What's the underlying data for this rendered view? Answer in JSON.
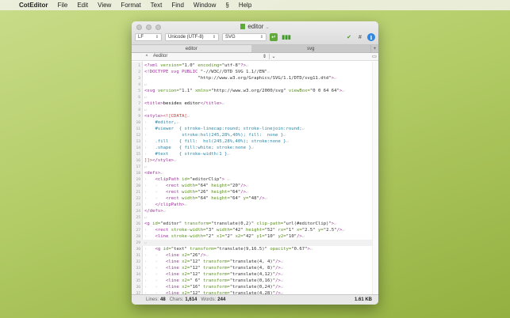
{
  "menubar": {
    "app": "CotEditor",
    "items": [
      "File",
      "Edit",
      "View",
      "Format",
      "Text",
      "Find",
      "Window",
      "Help"
    ]
  },
  "window": {
    "title": "editor"
  },
  "toolbar": {
    "line_ending": "LF",
    "encoding": "Unicode (UTF-8)",
    "syntax": "SVG"
  },
  "tabs": [
    "editor",
    "svg"
  ],
  "nav": {
    "path": "#editor"
  },
  "code": [
    [
      [
        "t-tag",
        "<?xml "
      ],
      [
        "t-attr",
        "version="
      ],
      [
        "t-str",
        "\"1.0\" "
      ],
      [
        "t-attr",
        "encoding="
      ],
      [
        "t-str",
        "\"utf-8\""
      ],
      [
        "t-tag",
        "?>"
      ],
      [
        "t-inv",
        "↵"
      ]
    ],
    [
      [
        "t-tag",
        "<!DOCTYPE svg PUBLIC "
      ],
      [
        "t-str",
        "\"-//W3C//DTD SVG 1.1//EN\""
      ],
      [
        "t-inv",
        "↵"
      ]
    ],
    [
      [
        "t-str",
        "                    \"http://www.w3.org/Graphics/SVG/1.1/DTD/svg11.dtd\""
      ],
      [
        "t-tag",
        ">"
      ],
      [
        "t-inv",
        "↵"
      ]
    ],
    [
      [
        "t-inv",
        "↵"
      ]
    ],
    [
      [
        "t-tag",
        "<svg "
      ],
      [
        "t-attr",
        "version="
      ],
      [
        "t-str",
        "\"1.1\" "
      ],
      [
        "t-attr",
        "xmlns="
      ],
      [
        "t-str",
        "\"http://www.w3.org/2000/svg\" "
      ],
      [
        "t-attr",
        "viewBox="
      ],
      [
        "t-str",
        "\"0 0 64 64\""
      ],
      [
        "t-tag",
        ">"
      ],
      [
        "t-inv",
        "↵"
      ]
    ],
    [
      [
        "t-inv",
        "↵"
      ]
    ],
    [
      [
        "t-tag",
        "<title>"
      ],
      [
        "t-txt",
        "besides editor"
      ],
      [
        "t-tag",
        "</title>"
      ],
      [
        "t-inv",
        "↵"
      ]
    ],
    [
      [
        "t-inv",
        "↵"
      ]
    ],
    [
      [
        "t-tag",
        "<style>"
      ],
      [
        "t-cd",
        "<![CDATA["
      ],
      [
        "t-inv",
        "↵"
      ]
    ],
    [
      [
        "t-inv",
        "›   "
      ],
      [
        "t-css",
        "#editor,"
      ],
      [
        "t-inv",
        "↵"
      ]
    ],
    [
      [
        "t-inv",
        "›   "
      ],
      [
        "t-css",
        "#viewer  { stroke-linecap:round; stroke-linejoin:round;"
      ],
      [
        "t-inv",
        "↵"
      ]
    ],
    [
      [
        "t-inv",
        "›   "
      ],
      [
        "t-css",
        "          stroke:hsl(245,28%,40%); fill:  none }"
      ],
      [
        "t-inv",
        "↵"
      ]
    ],
    [
      [
        "t-inv",
        "›   "
      ],
      [
        "t-css",
        ".fill    { fill:  hsl(245,28%,40%); stroke:none }"
      ],
      [
        "t-inv",
        "↵"
      ]
    ],
    [
      [
        "t-inv",
        "›   "
      ],
      [
        "t-css",
        ".shape   { fill:white; stroke:none }"
      ],
      [
        "t-inv",
        "↵"
      ]
    ],
    [
      [
        "t-inv",
        "›   "
      ],
      [
        "t-css",
        "#text    { stroke-width:1 }"
      ],
      [
        "t-inv",
        "↵"
      ]
    ],
    [
      [
        "t-cd",
        "]]>"
      ],
      [
        "t-tag",
        "</style>"
      ],
      [
        "t-inv",
        "↵"
      ]
    ],
    [
      [
        "t-inv",
        "↵"
      ]
    ],
    [
      [
        "t-tag",
        "<defs>"
      ],
      [
        "t-inv",
        "↵"
      ]
    ],
    [
      [
        "t-inv",
        "›   "
      ],
      [
        "t-tag",
        "<clipPath "
      ],
      [
        "t-attr",
        "id="
      ],
      [
        "t-str",
        "\"editorClip\""
      ],
      [
        "t-tag",
        ">"
      ],
      [
        "t-inv",
        " ↵"
      ]
    ],
    [
      [
        "t-inv",
        "›   ›   "
      ],
      [
        "t-tag",
        "<rect "
      ],
      [
        "t-attr",
        "width="
      ],
      [
        "t-str",
        "\"64\" "
      ],
      [
        "t-attr",
        "height="
      ],
      [
        "t-str",
        "\"20\""
      ],
      [
        "t-tag",
        "/>"
      ],
      [
        "t-inv",
        "↵"
      ]
    ],
    [
      [
        "t-inv",
        "›   ›   "
      ],
      [
        "t-tag",
        "<rect "
      ],
      [
        "t-attr",
        "width="
      ],
      [
        "t-str",
        "\"26\" "
      ],
      [
        "t-attr",
        "height="
      ],
      [
        "t-str",
        "\"64\""
      ],
      [
        "t-tag",
        "/>"
      ],
      [
        "t-inv",
        "↵"
      ]
    ],
    [
      [
        "t-inv",
        "›   ›   "
      ],
      [
        "t-tag",
        "<rect "
      ],
      [
        "t-attr",
        "width="
      ],
      [
        "t-str",
        "\"64\" "
      ],
      [
        "t-attr",
        "height="
      ],
      [
        "t-str",
        "\"64\" "
      ],
      [
        "t-attr",
        "y="
      ],
      [
        "t-str",
        "\"48\""
      ],
      [
        "t-tag",
        "/>"
      ],
      [
        "t-inv",
        "↵"
      ]
    ],
    [
      [
        "t-inv",
        "›   "
      ],
      [
        "t-tag",
        "</clipPath>"
      ],
      [
        "t-inv",
        "↵"
      ]
    ],
    [
      [
        "t-tag",
        "</defs>"
      ],
      [
        "t-inv",
        "↵"
      ]
    ],
    [
      [
        "t-inv",
        "↵"
      ]
    ],
    [
      [
        "t-tag",
        "<g "
      ],
      [
        "t-attr",
        "id="
      ],
      [
        "t-str",
        "\"editor\" "
      ],
      [
        "t-attr",
        "transform="
      ],
      [
        "t-str",
        "\"translate(0,2)\" "
      ],
      [
        "t-attr",
        "clip-path="
      ],
      [
        "t-str",
        "\"url(#editorClip)\""
      ],
      [
        "t-tag",
        ">"
      ],
      [
        "t-inv",
        "↵"
      ]
    ],
    [
      [
        "t-inv",
        "›   "
      ],
      [
        "t-tag",
        "<rect "
      ],
      [
        "t-attr",
        "stroke-width="
      ],
      [
        "t-str",
        "\"3\" "
      ],
      [
        "t-attr",
        "width="
      ],
      [
        "t-str",
        "\"42\" "
      ],
      [
        "t-attr",
        "height="
      ],
      [
        "t-str",
        "\"52\" "
      ],
      [
        "t-attr",
        "rx="
      ],
      [
        "t-str",
        "\"1\" "
      ],
      [
        "t-attr",
        "x="
      ],
      [
        "t-str",
        "\"2.5\" "
      ],
      [
        "t-attr",
        "y="
      ],
      [
        "t-str",
        "\"2.5\""
      ],
      [
        "t-tag",
        "/>"
      ],
      [
        "t-inv",
        "↵"
      ]
    ],
    [
      [
        "t-inv",
        "›   "
      ],
      [
        "t-tag",
        "<line "
      ],
      [
        "t-attr",
        "stroke-width="
      ],
      [
        "t-str",
        "\"2\" "
      ],
      [
        "t-attr",
        "x1="
      ],
      [
        "t-str",
        "\"2\" "
      ],
      [
        "t-attr",
        "x2="
      ],
      [
        "t-str",
        "\"42\" "
      ],
      [
        "t-attr",
        "y1="
      ],
      [
        "t-str",
        "\"10\" "
      ],
      [
        "t-attr",
        "y2="
      ],
      [
        "t-str",
        "\"10\""
      ],
      [
        "t-tag",
        "/>"
      ],
      [
        "t-inv",
        "↵"
      ]
    ],
    [
      [
        "t-inv",
        "↵"
      ]
    ],
    [
      [
        "t-inv",
        "›   "
      ],
      [
        "t-tag",
        "<g "
      ],
      [
        "t-attr",
        "id="
      ],
      [
        "t-str",
        "\"text\" "
      ],
      [
        "t-attr",
        "transform="
      ],
      [
        "t-str",
        "\"translate(9,16.5)\" "
      ],
      [
        "t-attr",
        "opacity="
      ],
      [
        "t-str",
        "\"0.67\""
      ],
      [
        "t-tag",
        ">"
      ],
      [
        "t-inv",
        "↵"
      ]
    ],
    [
      [
        "t-inv",
        "›   ›   "
      ],
      [
        "t-tag",
        "<line "
      ],
      [
        "t-attr",
        "x2="
      ],
      [
        "t-str",
        "\"26\""
      ],
      [
        "t-tag",
        "/>"
      ],
      [
        "t-inv",
        "↵"
      ]
    ],
    [
      [
        "t-inv",
        "›   ›   "
      ],
      [
        "t-tag",
        "<line "
      ],
      [
        "t-attr",
        "x2="
      ],
      [
        "t-str",
        "\"12\" "
      ],
      [
        "t-attr",
        "transform="
      ],
      [
        "t-str",
        "\"translate(4, 4)\""
      ],
      [
        "t-tag",
        "/>"
      ],
      [
        "t-inv",
        "↵"
      ]
    ],
    [
      [
        "t-inv",
        "›   ›   "
      ],
      [
        "t-tag",
        "<line "
      ],
      [
        "t-attr",
        "x2="
      ],
      [
        "t-str",
        "\"12\" "
      ],
      [
        "t-attr",
        "transform="
      ],
      [
        "t-str",
        "\"translate(4, 8)\""
      ],
      [
        "t-tag",
        "/>"
      ],
      [
        "t-inv",
        "↵"
      ]
    ],
    [
      [
        "t-inv",
        "›   ›   "
      ],
      [
        "t-tag",
        "<line "
      ],
      [
        "t-attr",
        "x2="
      ],
      [
        "t-str",
        "\"12\" "
      ],
      [
        "t-attr",
        "transform="
      ],
      [
        "t-str",
        "\"translate(4,12)\""
      ],
      [
        "t-tag",
        "/>"
      ],
      [
        "t-inv",
        "↵"
      ]
    ],
    [
      [
        "t-inv",
        "›   ›   "
      ],
      [
        "t-tag",
        "<line "
      ],
      [
        "t-attr",
        "x2="
      ],
      [
        "t-str",
        "\" 6\" "
      ],
      [
        "t-attr",
        "transform="
      ],
      [
        "t-str",
        "\"translate(0,16)\""
      ],
      [
        "t-tag",
        "/>"
      ],
      [
        "t-inv",
        "↵"
      ]
    ],
    [
      [
        "t-inv",
        "›   ›   "
      ],
      [
        "t-tag",
        "<line "
      ],
      [
        "t-attr",
        "x2="
      ],
      [
        "t-str",
        "\"16\" "
      ],
      [
        "t-attr",
        "transform="
      ],
      [
        "t-str",
        "\"translate(0,24)\""
      ],
      [
        "t-tag",
        "/>"
      ],
      [
        "t-inv",
        "↵"
      ]
    ],
    [
      [
        "t-inv",
        "›   ›   "
      ],
      [
        "t-tag",
        "<line "
      ],
      [
        "t-attr",
        "x2="
      ],
      [
        "t-str",
        "\"12\" "
      ],
      [
        "t-attr",
        "transform="
      ],
      [
        "t-str",
        "\"translate(4,28)\""
      ],
      [
        "t-tag",
        "/>"
      ],
      [
        "t-inv",
        "↵"
      ]
    ]
  ],
  "current_line": 29,
  "status": {
    "lines_label": "Lines:",
    "lines": "48",
    "chars_label": "Chars:",
    "chars": "1,614",
    "words_label": "Words:",
    "words": "244",
    "size": "1.61 KB"
  }
}
